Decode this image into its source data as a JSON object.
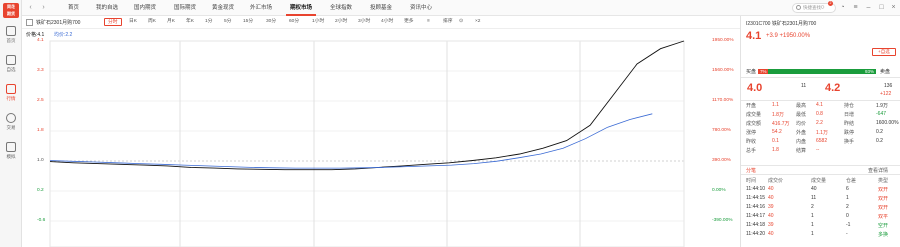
{
  "app": {
    "logo_line1": "同花",
    "logo_line2": "期货"
  },
  "sidebar": [
    {
      "label": "首页",
      "icon": "home-icon"
    },
    {
      "label": "自选",
      "icon": "star-icon"
    },
    {
      "label": "行情",
      "icon": "chart-icon",
      "active": true
    },
    {
      "label": "交易",
      "icon": "trade-icon"
    },
    {
      "label": "模拟",
      "icon": "sim-icon"
    }
  ],
  "topnav": {
    "tabs": [
      "首页",
      "我的自选",
      "国内期货",
      "国际期货",
      "黄金现货",
      "外汇市场",
      "期权市场",
      "全球指数",
      "投顾基金",
      "资讯中心"
    ],
    "active_tab": 6,
    "search_placeholder": "快捷查找",
    "badge_count": "2"
  },
  "stockbar": {
    "name": "铁矿石2301月购700",
    "periods": [
      "分时",
      "日K",
      "周K",
      "月K",
      "年K",
      "1分",
      "5分",
      "15分",
      "30分",
      "60分",
      "1小时",
      "2小时",
      "3小时",
      "4小时",
      "更多"
    ],
    "active_period": 0,
    "tools": [
      "≡",
      "排序",
      "⊙",
      "×2"
    ]
  },
  "chart": {
    "legend_price": "价格:4.1",
    "legend_avg": "均价:2.2",
    "left_ticks": [
      "4.1",
      "3.3",
      "2.5",
      "1.8",
      "1.0",
      "0.2",
      "-0.6"
    ],
    "right_ticks": [
      "1950.00%",
      "1560.00%",
      "1170.00%",
      "780.00%",
      "390.00%",
      "0.00%",
      "-390.00%"
    ],
    "colors": {
      "price": "#111111",
      "avg": "#3a6ad4",
      "up": "#e8442f",
      "down": "#1a9c3c"
    }
  },
  "chart_data": {
    "type": "line",
    "ylim": [
      -0.6,
      4.1
    ],
    "series": [
      {
        "values": [
          0.95,
          0.92,
          0.9,
          0.88,
          0.86,
          0.84,
          0.8,
          0.78,
          0.76,
          0.75,
          0.74,
          0.74,
          0.74,
          0.76,
          0.8,
          0.84,
          0.88,
          0.92,
          0.98,
          1.05,
          1.15,
          1.3,
          1.5,
          1.9,
          2.7,
          3.5,
          3.9,
          4.1
        ]
      },
      {
        "values": [
          0.98,
          0.96,
          0.94,
          0.92,
          0.9,
          0.88,
          0.86,
          0.84,
          0.82,
          0.8,
          0.79,
          0.78,
          0.78,
          0.78,
          0.79,
          0.8,
          0.82,
          0.84,
          0.86,
          0.9,
          0.96,
          1.05,
          1.15,
          1.3,
          1.55,
          1.85,
          2.05,
          2.2
        ]
      }
    ]
  },
  "panel": {
    "code": "I2301C700",
    "name": "铁矿石2301月购700",
    "price": "4.1",
    "change": "+3.9",
    "change_pct": "+1950.00%",
    "add_btn": "+自选",
    "buy_label": "买盘",
    "buy_pct": "7%",
    "sell_pct": "93%",
    "sell_label": "卖盘",
    "bid": "4.0",
    "bid_vol": "11",
    "ask": "4.2",
    "ask_vol": "136",
    "ask_extra": "+122",
    "stats": [
      [
        "开盘",
        "1.1",
        "最高",
        "4.1",
        "持仓",
        "1.9万"
      ],
      [
        "成交量",
        "1.8万",
        "最低",
        "0.8",
        "日增",
        "-647"
      ],
      [
        "成交额",
        "416.7万",
        "均价",
        "2.2",
        "昨结",
        "1600.00%"
      ],
      [
        "涨停",
        "54.2",
        "外盘",
        "1.1万",
        "跌停",
        "0.2"
      ],
      [
        "昨收",
        "0.1",
        "内盘",
        "6582",
        "换手",
        "0.2"
      ],
      [
        "总手",
        "1.8",
        "结算",
        "--",
        "",
        ""
      ]
    ],
    "tabs": [
      "分笔",
      "",
      "",
      "查看详情"
    ],
    "tick_header": [
      "时间",
      "成交价",
      "成交量",
      "仓差",
      "类型"
    ],
    "ticks": [
      [
        "11:44:10",
        "40",
        "40",
        "6",
        "双开"
      ],
      [
        "11:44:15",
        "40",
        "11",
        "1",
        "双开"
      ],
      [
        "11:44:16",
        "39",
        "2",
        "2",
        "双开"
      ],
      [
        "11:44:17",
        "40",
        "1",
        "0",
        "双平"
      ],
      [
        "11:44:18",
        "39",
        "1",
        "-1",
        "空开"
      ],
      [
        "11:44:20",
        "40",
        "1",
        "-",
        "多换"
      ]
    ]
  }
}
